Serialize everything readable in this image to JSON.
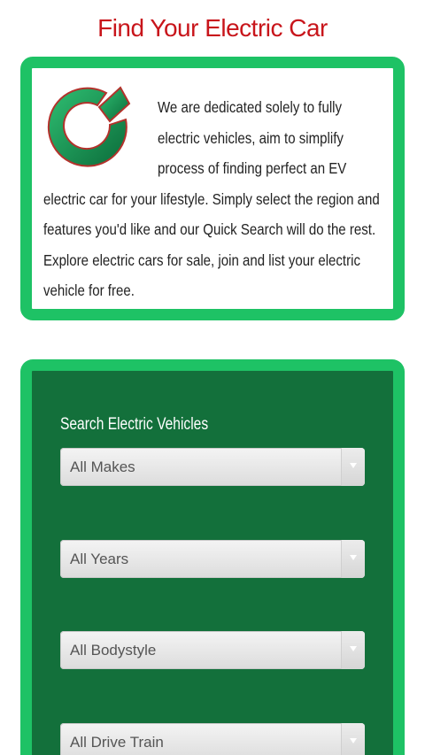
{
  "header": {
    "title": "Find Your Electric Car"
  },
  "intro": {
    "logo_icon": "ev-logo-icon",
    "text": "We are dedicated solely to fully electric vehicles, aim to simplify process of finding perfect an EV electric car for your lifestyle. Simply select the region and features you'd like and our Quick Search will do the rest. Explore electric cars for sale, join and list your electric vehicle for free."
  },
  "search": {
    "heading": "Search Electric Vehicles",
    "filters": [
      {
        "value": "All Makes"
      },
      {
        "value": "All Years"
      },
      {
        "value": "All Bodystyle"
      },
      {
        "value": "All Drive Train"
      }
    ]
  },
  "colors": {
    "title": "#c8151b",
    "card_border": "#1ec265",
    "search_bg": "#13703b"
  }
}
